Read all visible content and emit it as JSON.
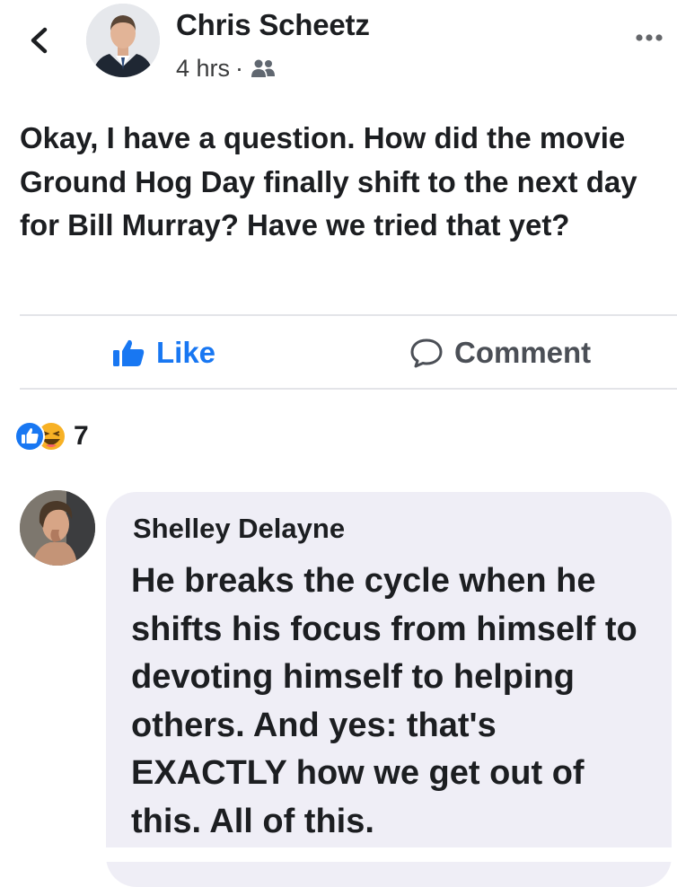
{
  "post": {
    "author": "Chris Scheetz",
    "time": "4 hrs",
    "separator": "·",
    "audience_icon": "friends-icon",
    "text": "Okay, I have a question. How did the movie Ground Hog Day finally shift to the next day for Bill Murray? Have we tried that yet?"
  },
  "actions": {
    "like_label": "Like",
    "comment_label": "Comment"
  },
  "reactions": {
    "icons": [
      "like-reaction-icon",
      "haha-reaction-icon"
    ],
    "count": "7"
  },
  "comment": {
    "author": "Shelley Delayne",
    "text": "He breaks the cycle when he shifts his focus from himself to devoting himself to helping others. And yes: that's EXACTLY how we get out of this. All of this."
  },
  "colors": {
    "accent": "#1877f2",
    "text": "#1c1e21",
    "bubble": "#efeef6",
    "divider": "#e3e4e8"
  }
}
